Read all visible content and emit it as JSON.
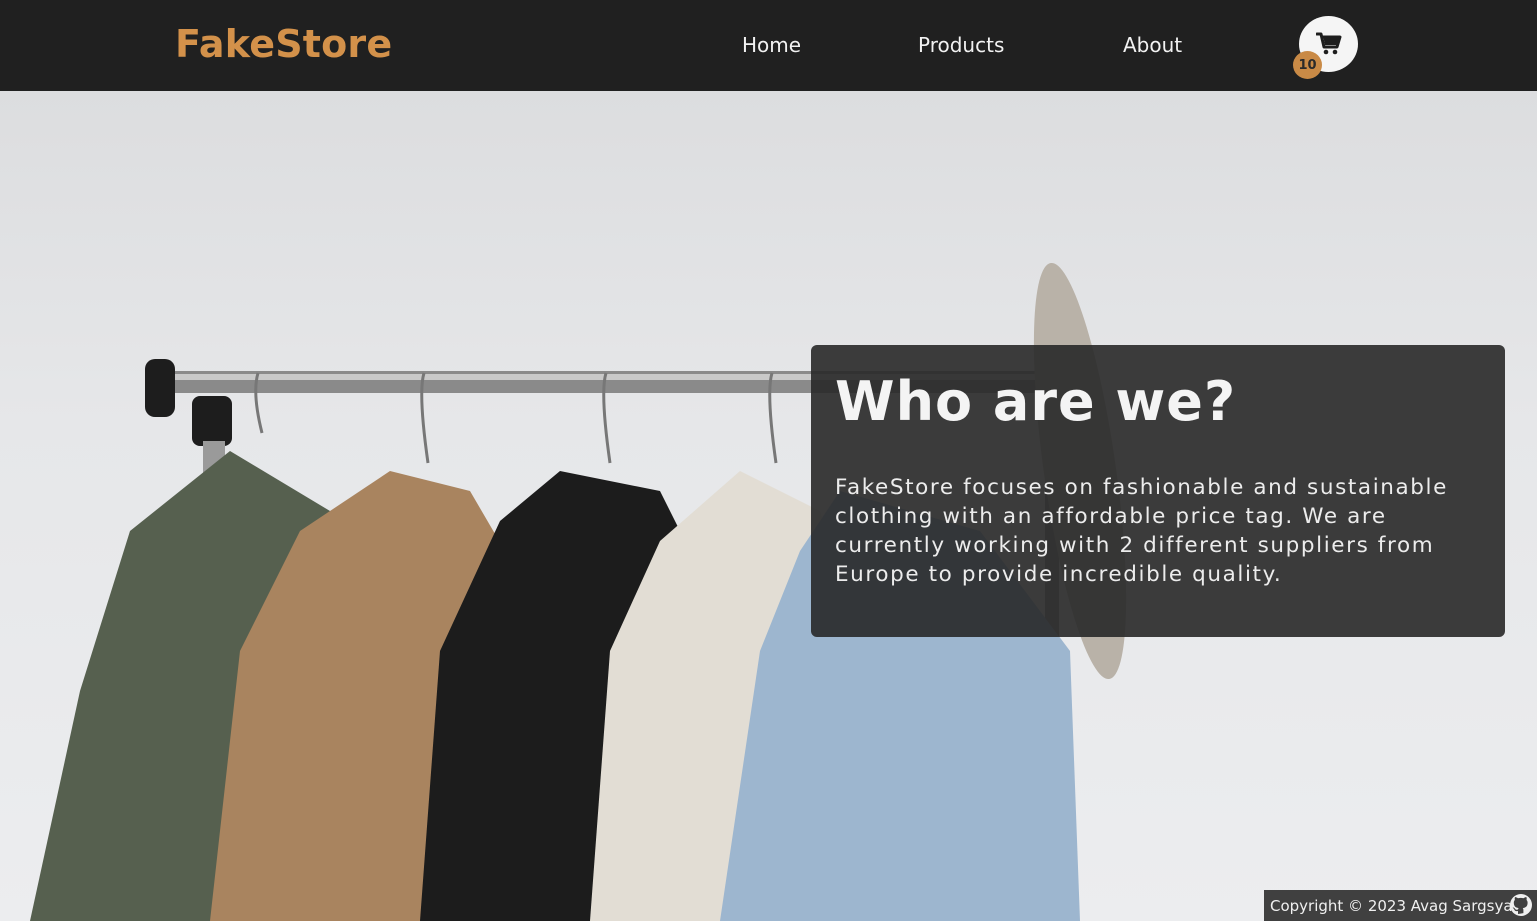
{
  "brand": {
    "name": "FakeStore",
    "color": "#d3914a"
  },
  "nav": {
    "items": [
      {
        "label": "Home"
      },
      {
        "label": "Products"
      },
      {
        "label": "About"
      }
    ]
  },
  "cart": {
    "icon": "cart-icon",
    "count": "10"
  },
  "about": {
    "title": "Who are we?",
    "text": "FakeStore focuses on fashionable and sustainable clothing with an affordable price tag. We are currently working with 2 different suppliers from Europe to provide incredible quality."
  },
  "footer": {
    "copyright": "Copyright © 2023 Avag Sargsyan",
    "icon": "github-icon"
  },
  "colors": {
    "header_bg": "#202020",
    "accent": "#c98a46",
    "card_bg": "#282828"
  }
}
